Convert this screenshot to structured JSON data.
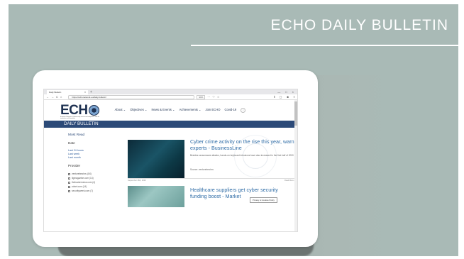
{
  "slide": {
    "title": "ECHO DAILY BULLETIN"
  },
  "browser": {
    "tab_title": "Daily Bulletin",
    "tab_close": "×",
    "new_tab": "+",
    "window_controls": [
      "—",
      "□",
      "×"
    ],
    "nav_icons": [
      "←",
      "→",
      "C",
      "⌂"
    ],
    "url": "https://echonetwork.eu/daily-bulletin/",
    "zoom": "90%",
    "right_icons": [
      "···",
      "♡",
      "☆",
      "⫴",
      "▢",
      "☻",
      "≡"
    ]
  },
  "site": {
    "logo_text": "ECH",
    "logo_subtitle": "European Network of Cybersecurity centres and competence Hub for innovation and Operations",
    "menu": [
      "About ⌄",
      "Objectives ⌄",
      "News & Events ⌄",
      "Achievements ⌄",
      "Join ECHO",
      "Covid-19"
    ],
    "search_glyph": "⌕",
    "section_bar": "DAILY BULLETIN"
  },
  "sidebar": {
    "most_read": "Most Read",
    "date_label": "Date",
    "date_links": [
      "Last 24 hours",
      "Last week",
      "Last month"
    ],
    "provider_label": "Provider",
    "providers": [
      "venturebeat.eu (84)",
      "itgmagazine.com (14)",
      "thehackernews.com (4)",
      "zdnet.com (14)",
      "securityweek.com (7)"
    ]
  },
  "articles": [
    {
      "title": "Cyber crime activity on the rise this year, warn experts - BusinessLine",
      "description": "Besides ransomware attacks, hands-on keyboard intrusions have also increased in the first half of 2020",
      "source": "Source: venturebeat.eu",
      "date": "September 16th, 2020",
      "more": "Read More »"
    },
    {
      "title": "Healthcare suppliers get cyber security funding boost - Market",
      "privacy": "Privacy & Cookies Policy"
    }
  ],
  "colors": {
    "slide_bg": "#a9bab6",
    "brand_navy": "#1d3050",
    "bar_blue": "#2c4a78",
    "link_blue": "#2f6ca6"
  }
}
